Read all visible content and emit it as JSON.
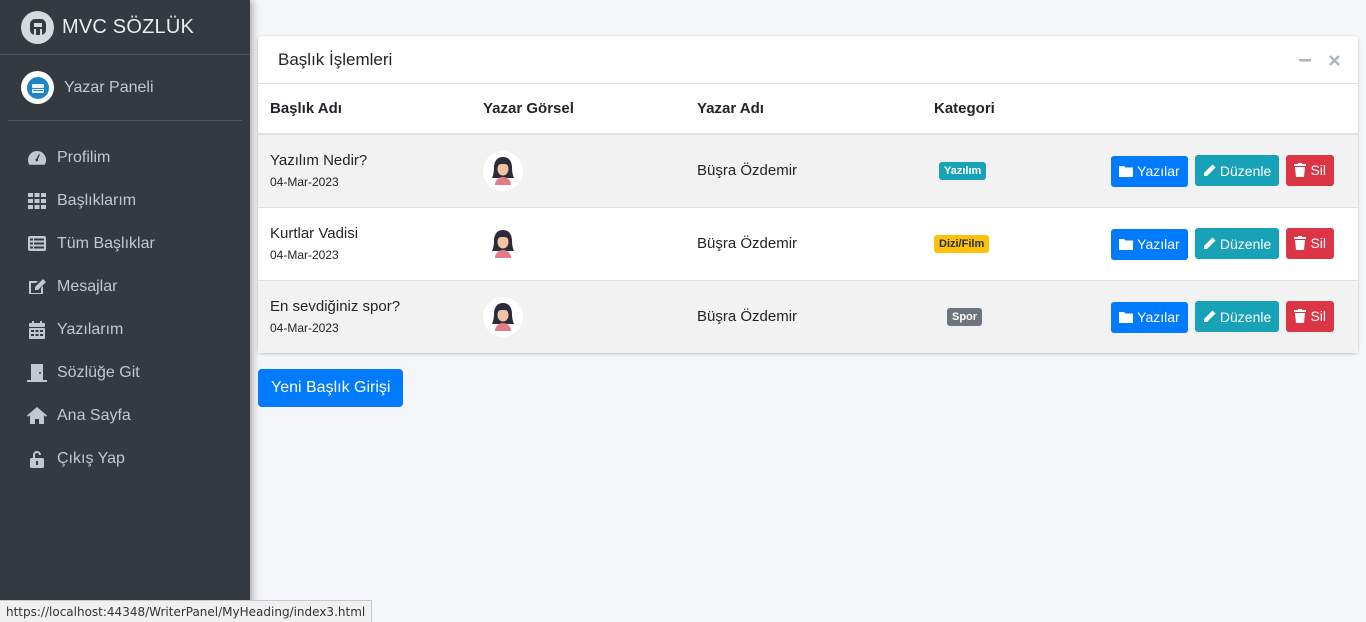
{
  "brand": {
    "name": "MVC SÖZLÜK",
    "logo_icon": "a-circle-icon"
  },
  "user_panel": {
    "name": "Yazar Paneli",
    "icon": "books-icon"
  },
  "nav": [
    {
      "label": "Profilim",
      "icon": "tachometer-icon"
    },
    {
      "label": "Başlıklarım",
      "icon": "grid-icon"
    },
    {
      "label": "Tüm Başlıklar",
      "icon": "list-icon"
    },
    {
      "label": "Mesajlar",
      "icon": "edit-icon"
    },
    {
      "label": "Yazılarım",
      "icon": "calendar-icon"
    },
    {
      "label": "Sözlüğe Git",
      "icon": "door-icon"
    },
    {
      "label": "Ana Sayfa",
      "icon": "home-icon"
    },
    {
      "label": "Çıkış Yap",
      "icon": "unlock-icon"
    }
  ],
  "card": {
    "title": "Başlık İşlemleri",
    "columns": [
      "Başlık Adı",
      "Yazar Görsel",
      "Yazar Adı",
      "Kategori",
      ""
    ],
    "rows": [
      {
        "title": "Yazılım Nedir?",
        "date": "04-Mar-2023",
        "author": "Büşra Özdemir",
        "category": "Yazılım",
        "category_color": "#17a2b8",
        "category_text_color": "#ffffff"
      },
      {
        "title": "Kurtlar Vadisi",
        "date": "04-Mar-2023",
        "author": "Büşra Özdemir",
        "category": "Dizi/Film",
        "category_color": "#ffc107",
        "category_text_color": "#1f2d3d"
      },
      {
        "title": "En sevdiğiniz spor?",
        "date": "04-Mar-2023",
        "author": "Büşra Özdemir",
        "category": "Spor",
        "category_color": "#6c757d",
        "category_text_color": "#ffffff"
      }
    ],
    "actions": {
      "posts": "Yazılar",
      "edit": "Düzenle",
      "delete": "Sil"
    }
  },
  "new_button": "Yeni Başlık Girişi",
  "status_url": "https://localhost:44348/WriterPanel/MyHeading/index3.html",
  "colors": {
    "primary": "#007bff",
    "info": "#17a2b8",
    "danger": "#dc3545",
    "sidebar": "#343a40"
  }
}
